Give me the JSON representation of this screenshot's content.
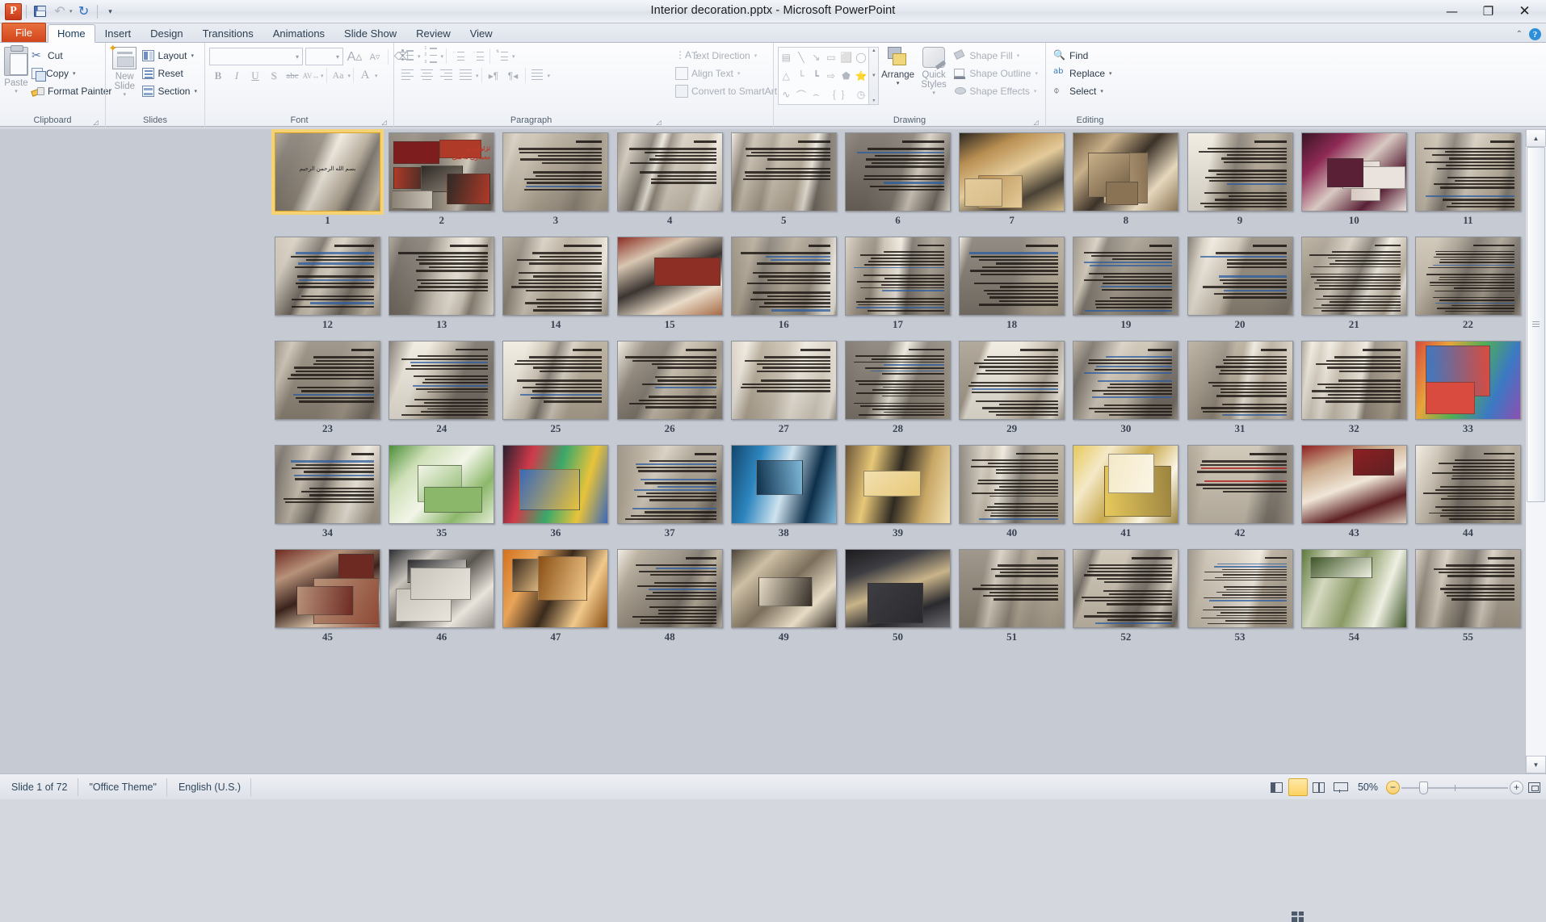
{
  "window": {
    "title": "Interior decoration.pptx  -  Microsoft PowerPoint",
    "app_icon": "P",
    "minimize": "—",
    "restore": "❐",
    "close": "✕"
  },
  "quick_access": {
    "save": "save-icon",
    "undo": "↶",
    "redo": "↻",
    "customize": "▾"
  },
  "ribbon": {
    "collapse": "⌃",
    "help": "?",
    "tabs": [
      {
        "label": "File",
        "kind": "file"
      },
      {
        "label": "Home",
        "kind": "active"
      },
      {
        "label": "Insert",
        "kind": "normal"
      },
      {
        "label": "Design",
        "kind": "normal"
      },
      {
        "label": "Transitions",
        "kind": "normal"
      },
      {
        "label": "Animations",
        "kind": "normal"
      },
      {
        "label": "Slide Show",
        "kind": "normal"
      },
      {
        "label": "Review",
        "kind": "normal"
      },
      {
        "label": "View",
        "kind": "normal"
      }
    ],
    "groups": {
      "clipboard": {
        "label": "Clipboard",
        "paste": "Paste",
        "cut": "Cut",
        "copy": "Copy",
        "format_painter": "Format Painter"
      },
      "slides": {
        "label": "Slides",
        "new_slide": "New Slide",
        "layout": "Layout",
        "reset": "Reset",
        "section": "Section"
      },
      "font": {
        "label": "Font",
        "font_name": "",
        "font_size": "",
        "grow": "A▴",
        "shrink": "A▾",
        "clear_formatting": "Clear Formatting",
        "bold": "B",
        "italic": "I",
        "underline": "U",
        "shadow": "S",
        "strikethrough": "abc",
        "character_spacing": "AV",
        "change_case": "Aa",
        "font_color": "A"
      },
      "paragraph": {
        "label": "Paragraph",
        "bullets": "Bullets",
        "numbering": "Numbering",
        "decrease_indent": "Decrease List Level",
        "increase_indent": "Increase List Level",
        "line_spacing": "Line Spacing",
        "align_left": "Align Text Left",
        "align_center": "Center",
        "align_right": "Align Text Right",
        "justify": "Justify",
        "ltr": "Left-to-Right",
        "rtl": "Right-to-Left",
        "columns": "Columns",
        "text_direction": "Text Direction",
        "align_text": "Align Text",
        "convert_to_smartart": "Convert to SmartArt"
      },
      "drawing": {
        "label": "Drawing",
        "arrange": "Arrange",
        "quick_styles": "Quick Styles",
        "shape_fill": "Shape Fill",
        "shape_outline": "Shape Outline",
        "shape_effects": "Shape Effects",
        "shapes": [
          "▤",
          "╲",
          "↘",
          "▭",
          "⬜",
          "◯",
          "△",
          "└",
          "┗",
          "⇨",
          "⬟",
          "⭐",
          "∿",
          "⌒",
          "⌢",
          "｛",
          "｝",
          "◷"
        ],
        "gallery_up": "▲",
        "gallery_down": "▼",
        "gallery_more": "▾"
      },
      "editing": {
        "label": "Editing",
        "find": "Find",
        "replace": "Replace",
        "select": "Select"
      }
    }
  },
  "sorter": {
    "rows": [
      {
        "slides": [
          {
            "n": "11",
            "style": "text",
            "selected": false
          },
          {
            "n": "10",
            "style": "photo-kitchen",
            "selected": false
          },
          {
            "n": "9",
            "style": "text",
            "selected": false
          },
          {
            "n": "8",
            "style": "photo-interior",
            "selected": false
          },
          {
            "n": "7",
            "style": "photo-loft",
            "selected": false
          },
          {
            "n": "6",
            "style": "text",
            "selected": false
          },
          {
            "n": "5",
            "style": "text",
            "selected": false
          },
          {
            "n": "4",
            "style": "text",
            "selected": false
          },
          {
            "n": "3",
            "style": "text",
            "selected": false
          },
          {
            "n": "2",
            "style": "title-collage",
            "caption": "تزئینات و معماری داخلی",
            "selected": false
          },
          {
            "n": "1",
            "style": "title-bismillah",
            "caption": "بسم الله الرحمن الرحیم",
            "selected": true
          }
        ]
      },
      {
        "slides": [
          {
            "n": "22",
            "style": "text"
          },
          {
            "n": "21",
            "style": "text"
          },
          {
            "n": "20",
            "style": "text"
          },
          {
            "n": "19",
            "style": "text"
          },
          {
            "n": "18",
            "style": "text"
          },
          {
            "n": "17",
            "style": "text"
          },
          {
            "n": "16",
            "style": "text"
          },
          {
            "n": "15",
            "style": "photo-closet"
          },
          {
            "n": "14",
            "style": "text"
          },
          {
            "n": "13",
            "style": "text"
          },
          {
            "n": "12",
            "style": "text"
          }
        ]
      },
      {
        "slides": [
          {
            "n": "33",
            "style": "photo-color"
          },
          {
            "n": "32",
            "style": "text"
          },
          {
            "n": "31",
            "style": "text"
          },
          {
            "n": "30",
            "style": "text"
          },
          {
            "n": "29",
            "style": "text"
          },
          {
            "n": "28",
            "style": "text"
          },
          {
            "n": "27",
            "style": "text"
          },
          {
            "n": "26",
            "style": "text"
          },
          {
            "n": "25",
            "style": "text"
          },
          {
            "n": "24",
            "style": "text"
          },
          {
            "n": "23",
            "style": "text"
          }
        ]
      },
      {
        "slides": [
          {
            "n": "44",
            "style": "text"
          },
          {
            "n": "43",
            "style": "photo-red-kitchen"
          },
          {
            "n": "42",
            "style": "text-red"
          },
          {
            "n": "41",
            "style": "photo-yellow"
          },
          {
            "n": "40",
            "style": "text"
          },
          {
            "n": "39",
            "style": "photo-lamp"
          },
          {
            "n": "38",
            "style": "photo-blue"
          },
          {
            "n": "37",
            "style": "text-blue"
          },
          {
            "n": "36",
            "style": "photo-grid"
          },
          {
            "n": "35",
            "style": "photo-green"
          },
          {
            "n": "34",
            "style": "text"
          }
        ]
      },
      {
        "slides": [
          {
            "n": "55",
            "style": "text"
          },
          {
            "n": "54",
            "style": "photo-green-room"
          },
          {
            "n": "53",
            "style": "text"
          },
          {
            "n": "52",
            "style": "text"
          },
          {
            "n": "51",
            "style": "text"
          },
          {
            "n": "50",
            "style": "photo-dark"
          },
          {
            "n": "49",
            "style": "photo-bed"
          },
          {
            "n": "48",
            "style": "text"
          },
          {
            "n": "47",
            "style": "photo-orange"
          },
          {
            "n": "46",
            "style": "photo-bathroom"
          },
          {
            "n": "45",
            "style": "photo-classic"
          }
        ]
      }
    ],
    "scroll_up": "▲",
    "scroll_down": "▼"
  },
  "status": {
    "slide_counter": "Slide 1 of 72",
    "theme": "\"Office Theme\"",
    "language": "English (U.S.)",
    "zoom_level": "50%",
    "zoom_out": "−",
    "zoom_in": "+",
    "views": [
      {
        "name": "normal",
        "title": "Normal",
        "active": false
      },
      {
        "name": "slide-sorter",
        "title": "Slide Sorter",
        "active": true
      },
      {
        "name": "reading",
        "title": "Reading View",
        "active": false
      },
      {
        "name": "slide-show",
        "title": "Slide Show",
        "active": false
      }
    ],
    "fit_to_window": "Fit slide to current window"
  }
}
